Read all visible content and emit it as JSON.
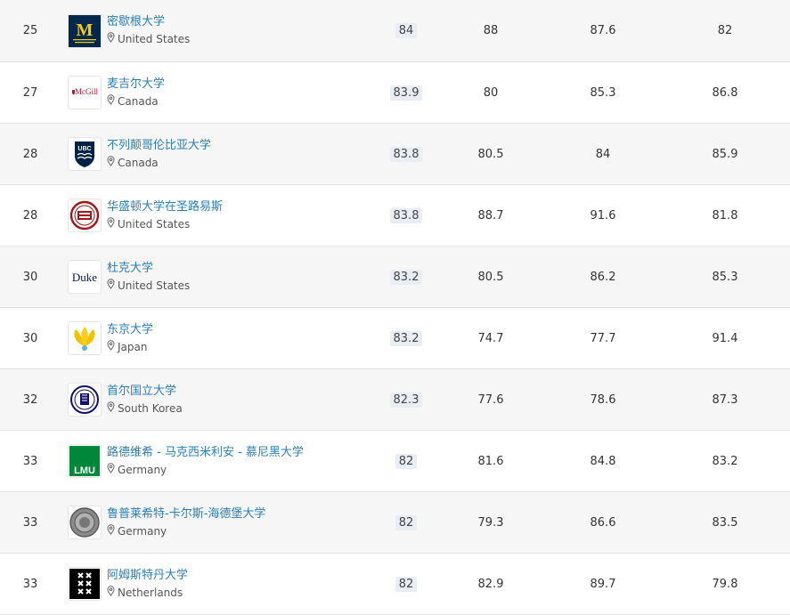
{
  "rows": [
    {
      "rank": "25",
      "name": "密歇根大学",
      "country": "United States",
      "overall": "84",
      "v2": "88",
      "v3": "87.6",
      "v4": "82",
      "logo": "michigan",
      "logo_text": "M"
    },
    {
      "rank": "27",
      "name": "麦吉尔大学",
      "country": "Canada",
      "overall": "83.9",
      "v2": "80",
      "v3": "85.3",
      "v4": "86.8",
      "logo": "mcgill",
      "logo_text": "McGill"
    },
    {
      "rank": "28",
      "name": "不列颠哥伦比亚大学",
      "country": "Canada",
      "overall": "83.8",
      "v2": "80.5",
      "v3": "84",
      "v4": "85.9",
      "logo": "ubc",
      "logo_text": "UBC"
    },
    {
      "rank": "28",
      "name": "华盛顿大学在圣路易斯",
      "country": "United States",
      "overall": "83.8",
      "v2": "88.7",
      "v3": "91.6",
      "v4": "81.8",
      "logo": "washu",
      "logo_text": ""
    },
    {
      "rank": "30",
      "name": "杜克大学",
      "country": "United States",
      "overall": "83.2",
      "v2": "80.5",
      "v3": "86.2",
      "v4": "85.3",
      "logo": "duke",
      "logo_text": "Duke"
    },
    {
      "rank": "30",
      "name": "东京大学",
      "country": "Japan",
      "overall": "83.2",
      "v2": "74.7",
      "v3": "77.7",
      "v4": "91.4",
      "logo": "tokyo",
      "logo_text": ""
    },
    {
      "rank": "32",
      "name": "首尔国立大学",
      "country": "South Korea",
      "overall": "82.3",
      "v2": "77.6",
      "v3": "78.6",
      "v4": "87.3",
      "logo": "snu",
      "logo_text": ""
    },
    {
      "rank": "33",
      "name": "路德维希 - 马克西米利安 - 慕尼黑大学",
      "country": "Germany",
      "overall": "82",
      "v2": "81.6",
      "v3": "84.8",
      "v4": "83.2",
      "logo": "lmu",
      "logo_text": "LMU"
    },
    {
      "rank": "33",
      "name": "鲁普莱希特-卡尔斯-海德堡大学",
      "country": "Germany",
      "overall": "82",
      "v2": "79.3",
      "v3": "86.6",
      "v4": "83.5",
      "logo": "heidelberg",
      "logo_text": ""
    },
    {
      "rank": "33",
      "name": "阿姆斯特丹大学",
      "country": "Netherlands",
      "overall": "82",
      "v2": "82.9",
      "v3": "89.7",
      "v4": "79.8",
      "logo": "uva",
      "logo_text": ""
    }
  ],
  "colors": {
    "link": "#2b7fb5",
    "pill": "#e9eef5",
    "alt_row": "#f6f6f6"
  }
}
